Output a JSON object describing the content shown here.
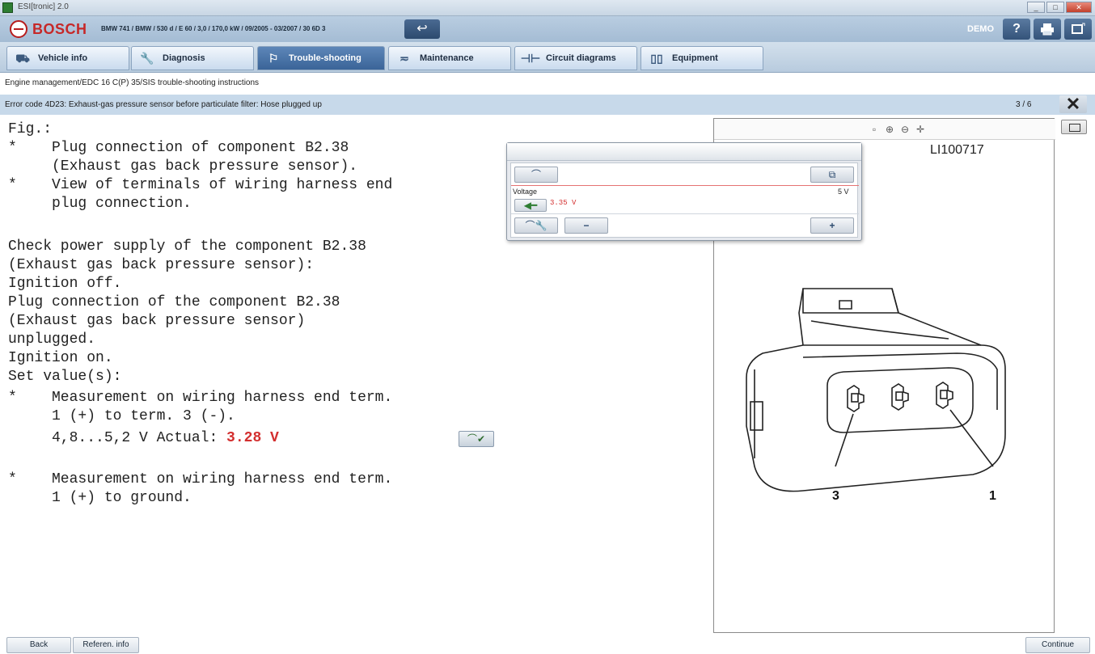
{
  "window": {
    "title": "ESI[tronic] 2.0"
  },
  "header": {
    "brand": "BOSCH",
    "vehicle": "BMW 741 / BMW / 530 d / E 60 / 3,0 / 170,0 kW / 09/2005 - 03/2007 / 30 6D 3",
    "mode_label": "DEMO",
    "help_symbol": "?",
    "icons": [
      "bosch-logo",
      "back-arrow-icon",
      "help-icon",
      "print-icon",
      "window-icon"
    ]
  },
  "tabs": [
    {
      "label": "Vehicle info",
      "icon": "car-icon"
    },
    {
      "label": "Diagnosis",
      "icon": "wrench-icon"
    },
    {
      "label": "Trouble-shooting",
      "icon": "people-icon",
      "active": true
    },
    {
      "label": "Maintenance",
      "icon": "maintenance-icon"
    },
    {
      "label": "Circuit diagrams",
      "icon": "circuit-icon"
    },
    {
      "label": "Equipment",
      "icon": "book-icon"
    }
  ],
  "breadcrumb": "Engine management/EDC 16 C(P) 35/SIS trouble-shooting instructions",
  "error": {
    "text": "Error code 4D23: Exhaust-gas pressure sensor before particulate filter: Hose plugged up",
    "page": "3 / 6"
  },
  "instructions": {
    "l1": "Fig.:",
    "l2": "*    Plug connection of component B2.38",
    "l3": "     (Exhaust gas back pressure sensor).",
    "l4": "*    View of terminals of wiring harness end",
    "l5": "     plug connection.",
    "l6": "Check power supply of the component B2.38",
    "l7": "(Exhaust gas back pressure sensor):",
    "l8": "Ignition off.",
    "l9": "Plug connection of the component B2.38",
    "l10": "(Exhaust gas back pressure sensor)",
    "l11": "unplugged.",
    "l12": "Ignition on.",
    "l13": "Set value(s):",
    "l14": "*    Measurement on wiring harness end term.",
    "l15": "     1 (+) to term. 3 (-).",
    "l16_prefix": "     4,8...5,2 V Actual: ",
    "actual_value": "3.28 V",
    "l17": "*    Measurement on wiring harness end term.",
    "l18": "     1 (+) to ground."
  },
  "meter": {
    "label": "Voltage",
    "value": "3.35 V",
    "max": "5 V",
    "minus": "−",
    "plus": "+"
  },
  "figure": {
    "code": "LI100717",
    "pin_left": "3",
    "pin_right": "1"
  },
  "footer": {
    "back": "Back",
    "referen": "Referen. info",
    "continue": "Continue"
  }
}
